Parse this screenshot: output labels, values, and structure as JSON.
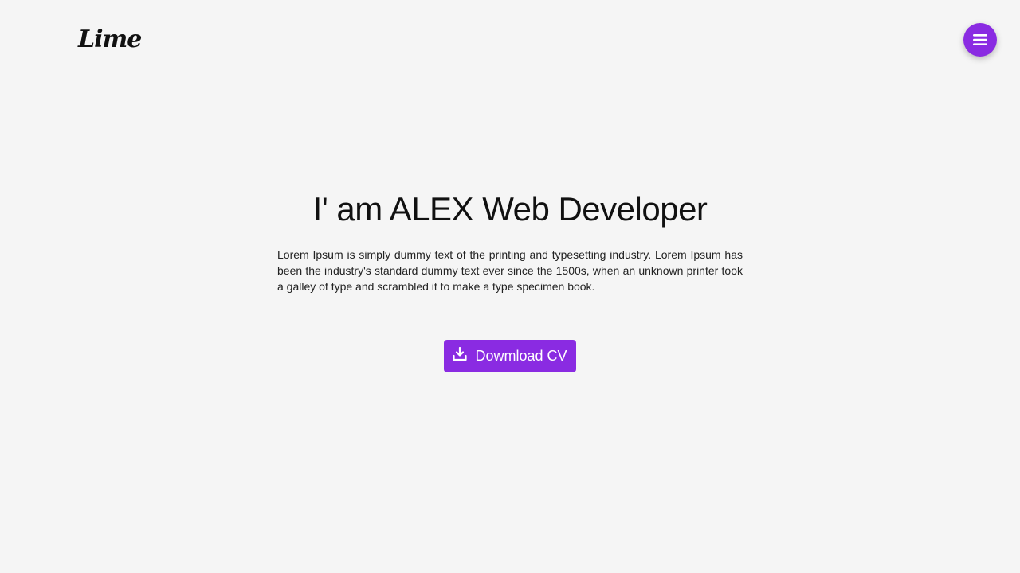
{
  "header": {
    "logo_text": "Lime",
    "menu_icon": "hamburger-menu-icon"
  },
  "hero": {
    "title": "I' am ALEX Web Developer",
    "description": "Lorem Ipsum is simply dummy text of the printing and typesetting industry. Lorem Ipsum has been the industry's standard dummy text ever since the 1500s, when an unknown printer took a galley of type and scrambled it to make a type specimen book.",
    "cv_button_label": "Dowmload CV",
    "cv_button_icon": "download-icon"
  },
  "colors": {
    "accent": "#8a2be2",
    "background": "#f5f5f5",
    "text": "#111111"
  }
}
